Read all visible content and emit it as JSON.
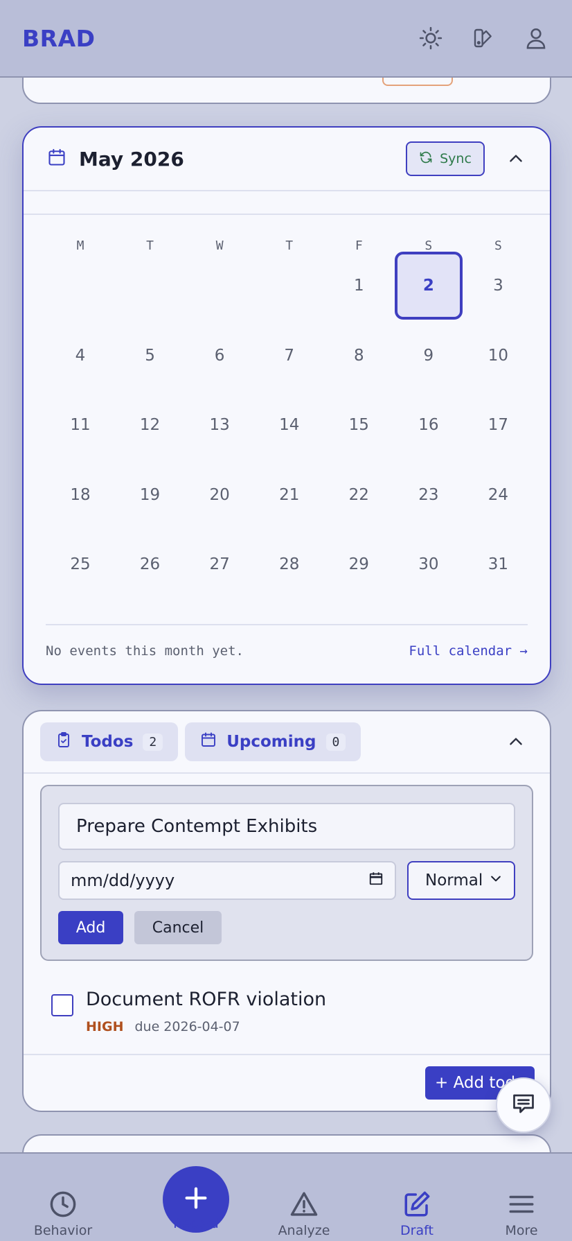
{
  "app": {
    "brand": "BRAD"
  },
  "header": {
    "icons": [
      "sun-icon",
      "theme-palette-icon",
      "user-icon"
    ]
  },
  "calendar": {
    "title": "May 2026",
    "sync_label": "Sync",
    "weekdays": [
      "M",
      "T",
      "W",
      "T",
      "F",
      "S",
      "S"
    ],
    "days": [
      "1",
      "2",
      "3",
      "4",
      "5",
      "6",
      "7",
      "8",
      "9",
      "10",
      "11",
      "12",
      "13",
      "14",
      "15",
      "16",
      "17",
      "18",
      "19",
      "20",
      "21",
      "22",
      "23",
      "24",
      "25",
      "26",
      "27",
      "28",
      "29",
      "30",
      "31"
    ],
    "first_day_column": 4,
    "today": "2",
    "empty_text": "No events this month yet.",
    "full_calendar_link": "Full calendar →"
  },
  "todos": {
    "tabs": [
      {
        "label": "Todos",
        "count": "2"
      },
      {
        "label": "Upcoming",
        "count": "0"
      }
    ],
    "form": {
      "title_value": "Prepare Contempt Exhibits",
      "date_placeholder": "mm/dd/yyyy",
      "priority_value": "Normal",
      "add_label": "Add",
      "cancel_label": "Cancel"
    },
    "items": [
      {
        "title": "Document ROFR violation",
        "priority": "HIGH",
        "due": "due 2026-04-07"
      }
    ],
    "add_todo_label": "+ Add todo"
  },
  "nav": {
    "items": [
      {
        "label": "Behavior",
        "icon": "clock-icon"
      },
      {
        "label": "Record",
        "icon": "plus-icon"
      },
      {
        "label": "Analyze",
        "icon": "warning-triangle-icon"
      },
      {
        "label": "Draft",
        "icon": "edit-icon"
      },
      {
        "label": "More",
        "icon": "menu-icon"
      }
    ]
  },
  "colors": {
    "accent": "#3a3fc4",
    "sync_green": "#2e7a4a",
    "priority_high": "#b0501e",
    "header_bg": "#b9bed8"
  }
}
